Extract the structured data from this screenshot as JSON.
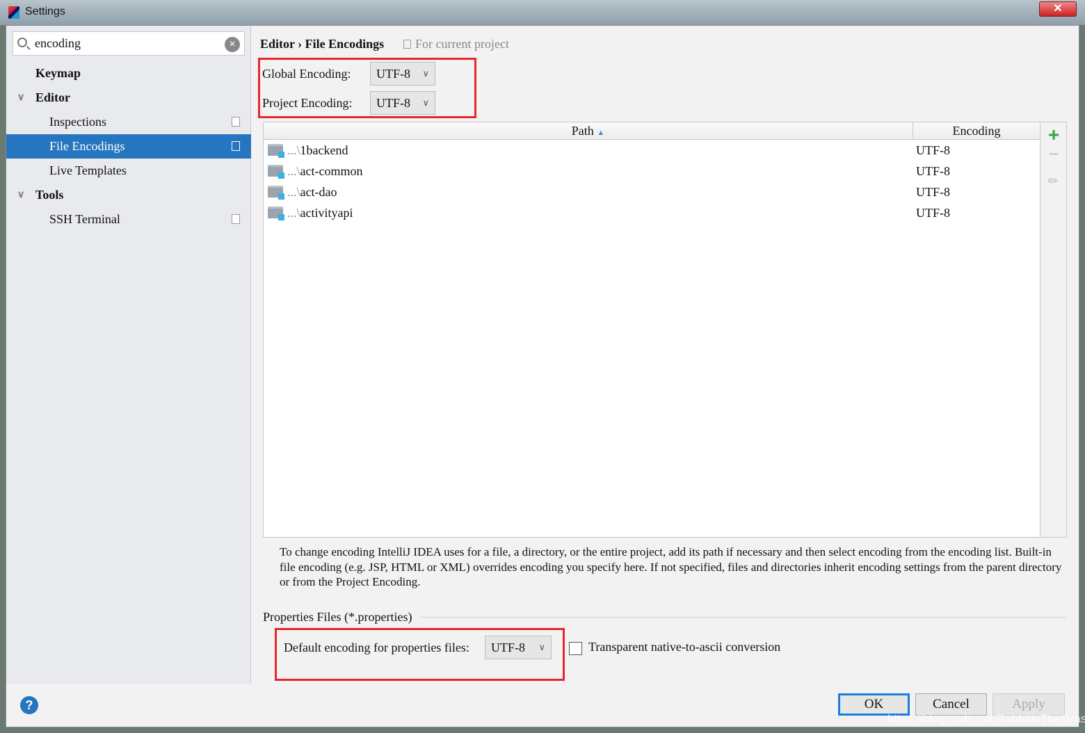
{
  "window": {
    "title": "Settings",
    "close": "✕"
  },
  "sidebar": {
    "search": {
      "value": "encoding"
    },
    "items": [
      {
        "label": "Keymap",
        "bold": true
      },
      {
        "label": "Editor",
        "bold": true,
        "expanded": true
      },
      {
        "label": "Inspections"
      },
      {
        "label": "File Encodings",
        "selected": true
      },
      {
        "label": "Live Templates"
      },
      {
        "label": "Tools",
        "bold": true,
        "expanded": true
      },
      {
        "label": "SSH Terminal"
      }
    ]
  },
  "main": {
    "breadcrumb": "Editor › File Encodings",
    "scope": "For current project",
    "global_label": "Global Encoding:",
    "global_value": "UTF-8",
    "project_label": "Project Encoding:",
    "project_value": "UTF-8",
    "table": {
      "col_path": "Path",
      "col_encoding": "Encoding",
      "rows": [
        {
          "prefix": "...\\",
          "name": "1backend",
          "encoding": "UTF-8"
        },
        {
          "prefix": "...\\",
          "name": "act-common",
          "encoding": "UTF-8"
        },
        {
          "prefix": "...\\",
          "name": "act-dao",
          "encoding": "UTF-8"
        },
        {
          "prefix": "...\\",
          "name": "activityapi",
          "encoding": "UTF-8"
        }
      ]
    },
    "description": "To change encoding IntelliJ IDEA uses for a file, a directory, or the entire project, add its path if necessary and then select encoding from the encoding list. Built-in file encoding (e.g. JSP, HTML or XML) overrides encoding you specify here. If not specified, files and directories inherit encoding settings from the parent directory or from the Project Encoding.",
    "properties_section": "Properties Files (*.properties)",
    "properties_label": "Default encoding for properties files:",
    "properties_value": "UTF-8",
    "transparent_label": "Transparent native-to-ascii conversion",
    "transparent_checked": false
  },
  "footer": {
    "help": "?",
    "ok": "OK",
    "cancel": "Cancel",
    "apply": "Apply"
  },
  "watermark": "https://blog.csdn.net/RabbitInTheGrass",
  "colors": {
    "selection": "#2675bf",
    "highlight_box": "#e8252c",
    "add": "#3ba33b"
  }
}
